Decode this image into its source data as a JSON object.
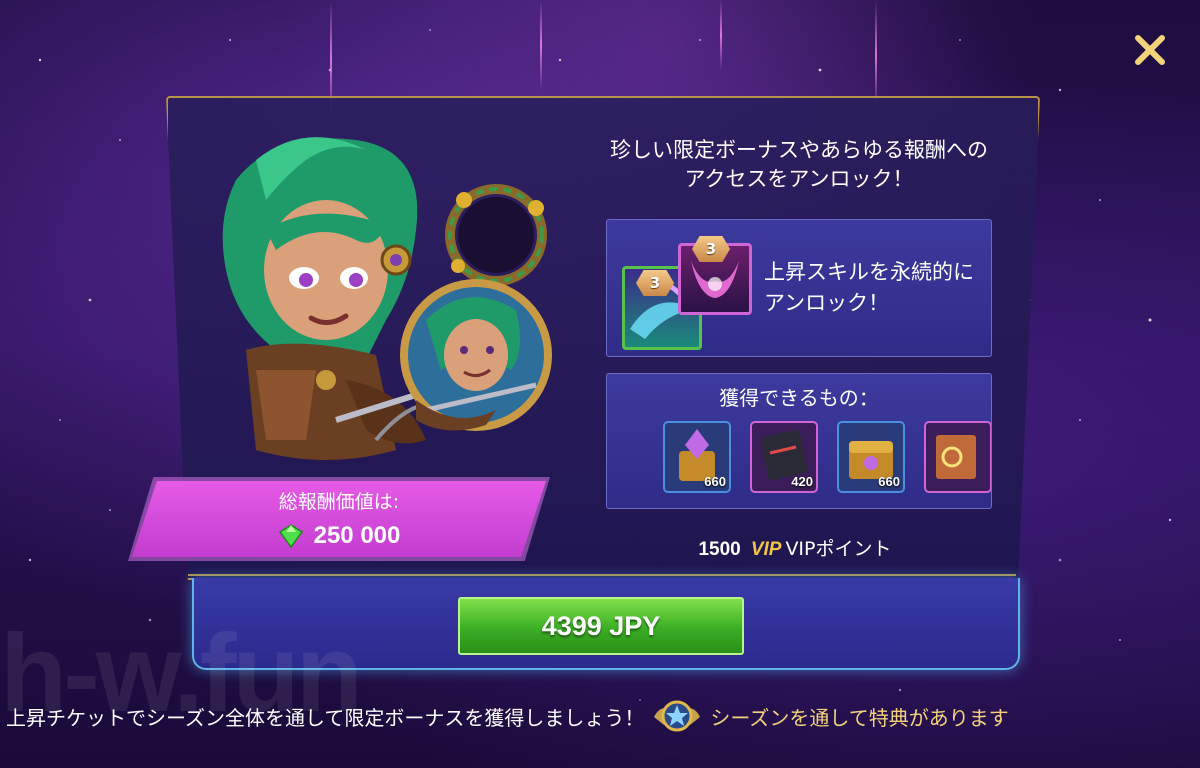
{
  "headline": "珍しい限定ボーナスやあらゆる報酬へのアクセスをアンロック！",
  "skill": {
    "text": "上昇スキルを永続的にアンロック！",
    "rank_left": "3",
    "rank_right": "3"
  },
  "rewards": {
    "title": "獲得できるもの：",
    "items": [
      {
        "icon": "crystal-chest-icon",
        "count": "660"
      },
      {
        "icon": "dark-scroll-icon",
        "count": "420"
      },
      {
        "icon": "treasure-chest-icon",
        "count": "660"
      },
      {
        "icon": "spellbook-icon",
        "count": ""
      }
    ]
  },
  "vip": {
    "amount": "1500",
    "badge": "VIP",
    "label": "VIPポイント"
  },
  "total_value": {
    "label": "総報酬価値は:",
    "amount": "250 000",
    "icon": "gem-icon"
  },
  "purchase": {
    "price_label": "4399 JPY"
  },
  "footer": {
    "text": "上昇チケットでシーズン全体を通して限定ボーナスを獲得しましょう！",
    "link": "シーズンを通して特典があります"
  },
  "watermark": "h-w.fun",
  "colors": {
    "accent_gold": "#f3d37a",
    "button_green": "#3cae25",
    "banner_pink": "#d84ad8",
    "panel_border": "#b79248"
  }
}
